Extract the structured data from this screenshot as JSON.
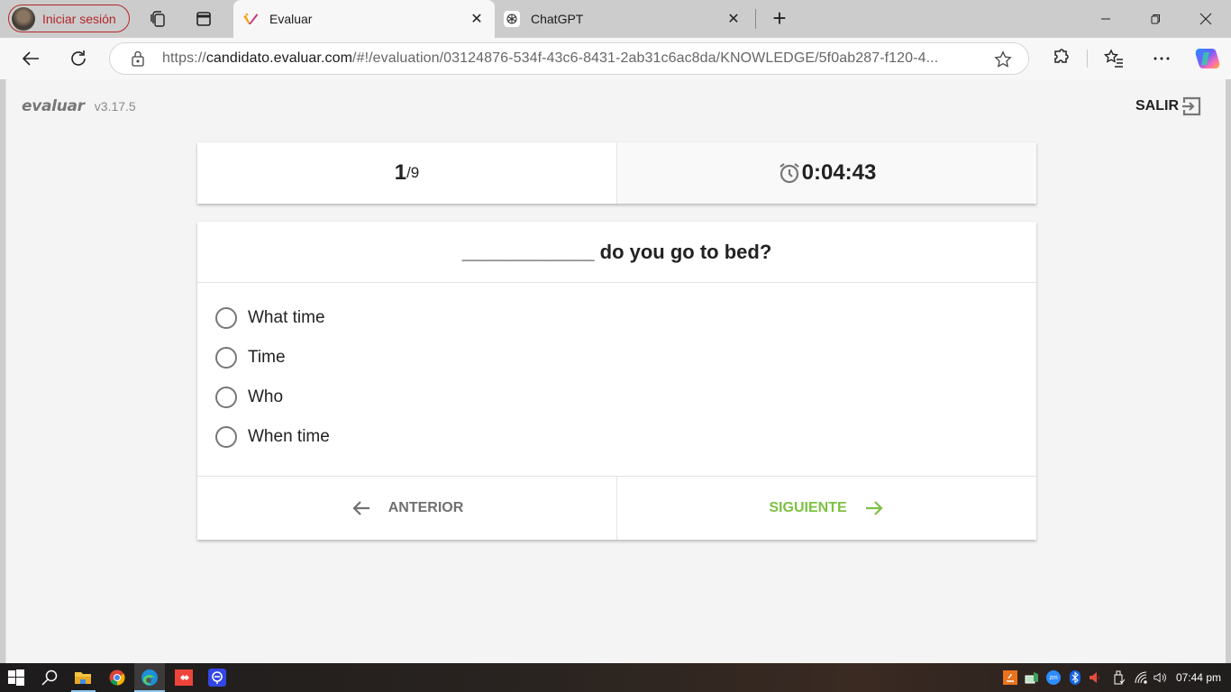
{
  "browser": {
    "profile_label": "Iniciar sesión",
    "tabs": [
      {
        "title": "Evaluar",
        "active": true,
        "favicon": "evaluar-v-icon"
      },
      {
        "title": "ChatGPT",
        "active": false,
        "favicon": "chatgpt-icon"
      }
    ],
    "new_tab_label": "+",
    "close_glyph": "✕",
    "url_prefix": "https://",
    "url_host": "candidato.evaluar.com",
    "url_path": "/#!/evaluation/03124876-534f-43c6-8431-2ab31c6ac8da/KNOWLEDGE/5f0ab287-f120-4..."
  },
  "app": {
    "logo": "evaluar",
    "version": "v3.17.5",
    "exit_label": "SALIR",
    "progress": {
      "current": "1",
      "total": "/9"
    },
    "timer": "0:04:43",
    "question": "____________ do you go to bed?",
    "options": [
      {
        "label": "What time",
        "selected": false
      },
      {
        "label": "Time",
        "selected": false
      },
      {
        "label": "Who",
        "selected": false
      },
      {
        "label": "When time",
        "selected": false
      }
    ],
    "prev_label": "ANTERIOR",
    "next_label": "SIGUIENTE",
    "colors": {
      "accent_next": "#7cc242",
      "prev": "#707070",
      "profile_border": "#b3262a"
    }
  },
  "taskbar": {
    "pinned": [
      "windows-start-icon",
      "search-icon",
      "file-explorer-icon",
      "chrome-icon",
      "edge-icon",
      "anydesk-icon",
      "remote-app-icon"
    ],
    "tray": [
      "java-update-icon",
      "network-share-icon",
      "zoom-icon",
      "bluetooth-icon",
      "muted-speaker-icon",
      "usb-device-icon",
      "wifi-icon",
      "volume-icon"
    ],
    "zoom_tray_label": "zm",
    "clock": "07:44 pm"
  }
}
